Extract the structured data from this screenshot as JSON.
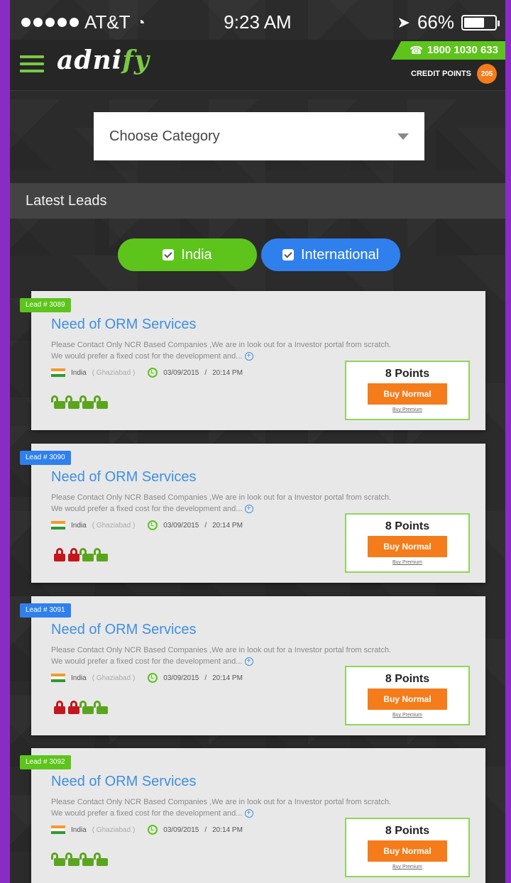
{
  "status_bar": {
    "carrier": "AT&T",
    "time": "9:23 AM",
    "battery": "66%",
    "battery_level": 0.66
  },
  "header": {
    "logo_prefix": "adni",
    "logo_suffix": "fy",
    "phone": "1800 1030 633",
    "credit_label": "CREDIT POINTS",
    "credit_count": "205"
  },
  "category": {
    "placeholder": "Choose Category"
  },
  "section": {
    "title": "Latest Leads"
  },
  "toggles": {
    "india": "India",
    "international": "International"
  },
  "leads": [
    {
      "tag": "Lead # 3089",
      "tag_color": "green",
      "title": "Need of ORM Services",
      "desc_line1": "Please Contact Only NCR Based Companies ,We are in look out for a Investor portal from scratch.",
      "desc_line2": "We would prefer a fixed cost for the development and...",
      "country": "India",
      "city": "( Ghaziabad )",
      "date": "03/09/2015",
      "time": "20:14 PM",
      "points": "8 Points",
      "buy_label": "Buy Normal",
      "premium_label": "Buy Premium",
      "locks": [
        "green",
        "green",
        "green",
        "green"
      ]
    },
    {
      "tag": "Lead # 3090",
      "tag_color": "blue",
      "title": "Need of ORM Services",
      "desc_line1": "Please Contact Only NCR Based Companies ,We are in look out for a Investor portal from scratch.",
      "desc_line2": "We would prefer a fixed cost for the development and...",
      "country": "India",
      "city": "( Ghaziabad )",
      "date": "03/09/2015",
      "time": "20:14 PM",
      "points": "8 Points",
      "buy_label": "Buy Normal",
      "premium_label": "Buy Premium",
      "locks": [
        "red",
        "red",
        "green",
        "green"
      ]
    },
    {
      "tag": "Lead # 3091",
      "tag_color": "blue",
      "title": "Need of ORM Services",
      "desc_line1": "Please Contact Only NCR Based Companies ,We are in look out for a Investor portal from scratch.",
      "desc_line2": "We would prefer a fixed cost for the development and...",
      "country": "India",
      "city": "( Ghaziabad )",
      "date": "03/09/2015",
      "time": "20:14 PM",
      "points": "8 Points",
      "buy_label": "Buy Normal",
      "premium_label": "Buy Premium",
      "locks": [
        "red",
        "red",
        "green",
        "green"
      ]
    },
    {
      "tag": "Lead # 3092",
      "tag_color": "green",
      "title": "Need of ORM Services",
      "desc_line1": "Please Contact Only NCR Based Companies ,We are in look out for a Investor portal from scratch.",
      "desc_line2": "We would prefer a fixed cost for the development and...",
      "country": "India",
      "city": "( Ghaziabad )",
      "date": "03/09/2015",
      "time": "20:14 PM",
      "points": "8 Points",
      "buy_label": "Buy Normal",
      "premium_label": "Buy Premium",
      "locks": [
        "green",
        "green",
        "green",
        "green"
      ]
    }
  ]
}
